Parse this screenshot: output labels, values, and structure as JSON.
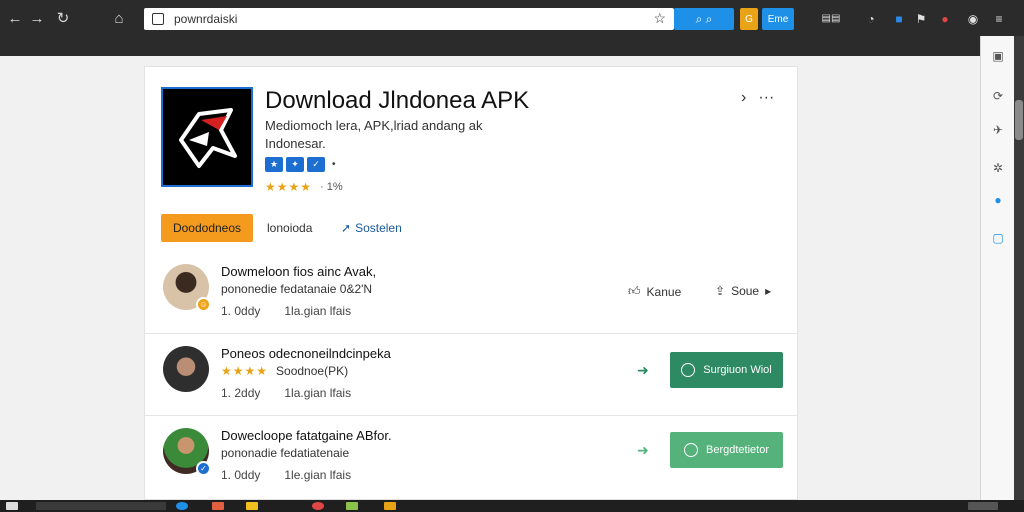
{
  "browser": {
    "address_url": "pownrdaiski",
    "toolbar_button_1": "Eme"
  },
  "app": {
    "title": "Download Jlndonea APK",
    "description": "Mediomoch lera, APK,lriad andang ak Indonesar.",
    "badges": [
      "★",
      "✦",
      "✓"
    ],
    "rating_stars": "★★★★",
    "rating_count": "· 1%"
  },
  "actions": {
    "download_label": "Doododneos",
    "link_label": "lonoioda",
    "share_link_label": "Sostelen"
  },
  "feed": [
    {
      "line1": "Dowmeloon fios ainc Avak,",
      "line2": "pononedie fedatanaie 0&2'N",
      "time": "1. 0ddy",
      "meta": "1la.gian lfais",
      "action1": "Kanue",
      "action2": "Soue",
      "avatar_color": "#c9b8a6",
      "mark_color": "#f0a31a"
    },
    {
      "line1": "Poneos odecnoneilndcinpeka",
      "stars": "★★★★",
      "line2": "Soodnoe(PK)",
      "time": "1. 2ddy",
      "meta": "1la.gian lfais",
      "button_label": "Surgiuon Wiol",
      "button_color": "#2e8a63",
      "avatar_color": "#3c3c3c"
    },
    {
      "line1": "Dowecloope fatatgaine ABfor.",
      "line2": "pononadie fedatiatenaie",
      "time": "1. 0ddy",
      "meta": "1le.gian lfais",
      "button_label": "Bergdtetietor",
      "button_color": "#54b27a",
      "avatar_color": "#3f2a24",
      "mark_color": "#1c6fd0"
    }
  ]
}
